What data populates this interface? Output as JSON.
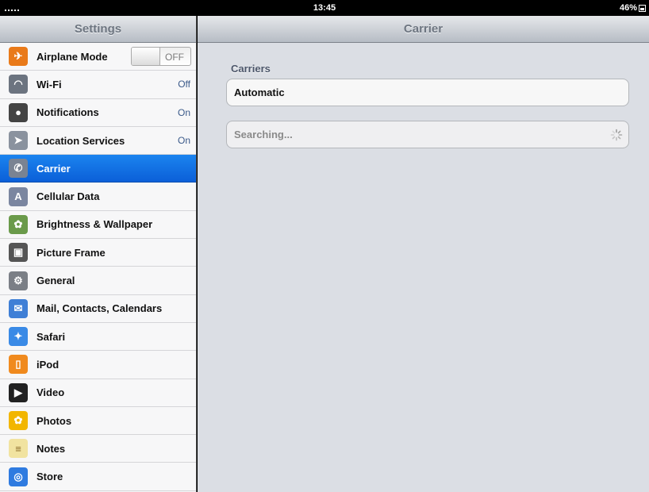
{
  "status_bar": {
    "time": "13:45",
    "battery": "46%"
  },
  "sidebar": {
    "title": "Settings",
    "items": [
      {
        "label": "Airplane Mode",
        "toggle": "OFF",
        "icon": "airplane-icon",
        "color": "#e97a1a"
      },
      {
        "label": "Wi-Fi",
        "value": "Off",
        "icon": "wifi-icon",
        "color": "#6c7480"
      },
      {
        "label": "Notifications",
        "value": "On",
        "icon": "notifications-icon",
        "color": "#444"
      },
      {
        "label": "Location Services",
        "value": "On",
        "icon": "location-icon",
        "color": "#8a929e"
      },
      {
        "label": "Carrier",
        "icon": "phone-icon",
        "color": "#7a8392",
        "selected": true
      },
      {
        "label": "Cellular Data",
        "icon": "cellular-icon",
        "color": "#7b86a0"
      },
      {
        "label": "Brightness & Wallpaper",
        "icon": "wallpaper-icon",
        "color": "#6a9a4a"
      },
      {
        "label": "Picture Frame",
        "icon": "picture-frame-icon",
        "color": "#555"
      },
      {
        "label": "General",
        "icon": "gear-icon",
        "color": "#7b7f86"
      },
      {
        "label": "Mail, Contacts, Calendars",
        "icon": "mail-icon",
        "color": "#3f7fd6"
      },
      {
        "label": "Safari",
        "icon": "safari-icon",
        "color": "#3a8ae6"
      },
      {
        "label": "iPod",
        "icon": "ipod-icon",
        "color": "#f08a1e"
      },
      {
        "label": "Video",
        "icon": "video-icon",
        "color": "#222"
      },
      {
        "label": "Photos",
        "icon": "photos-icon",
        "color": "#f2b600"
      },
      {
        "label": "Notes",
        "icon": "notes-icon",
        "color": "#f1e3a0"
      },
      {
        "label": "Store",
        "icon": "store-icon",
        "color": "#2f7be0"
      }
    ]
  },
  "main": {
    "title": "Carrier",
    "section_title": "Carriers",
    "automatic_label": "Automatic",
    "searching_label": "Searching..."
  }
}
